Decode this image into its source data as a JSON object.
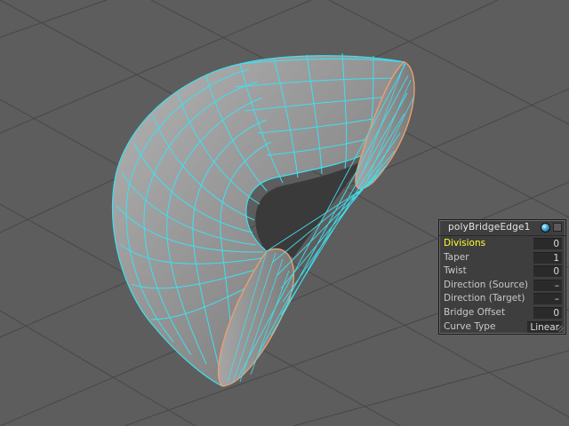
{
  "app": "3D modeling viewport",
  "inview_editor": {
    "title": "polyBridgeEdge1",
    "icons": {
      "edit": "sphere-icon",
      "close": "close-square-icon"
    },
    "attributes": [
      {
        "label": "Divisions",
        "value": "0",
        "active": true
      },
      {
        "label": "Taper",
        "value": "1",
        "active": false
      },
      {
        "label": "Twist",
        "value": "0",
        "active": false
      },
      {
        "label": "Direction (Source)",
        "value": "–",
        "active": false
      },
      {
        "label": "Direction (Target)",
        "value": "–",
        "active": false
      },
      {
        "label": "Bridge Offset",
        "value": "0",
        "active": false
      },
      {
        "label": "Curve Type",
        "value": "Linear",
        "active": false
      }
    ]
  },
  "colors": {
    "viewport_bg": "#5d5d5d",
    "grid": "#444444",
    "mesh_fill": "#8c8c8c",
    "wireframe": "#3fe0f0",
    "border_edge": "#e8a070",
    "active_label": "#ffff2e"
  }
}
